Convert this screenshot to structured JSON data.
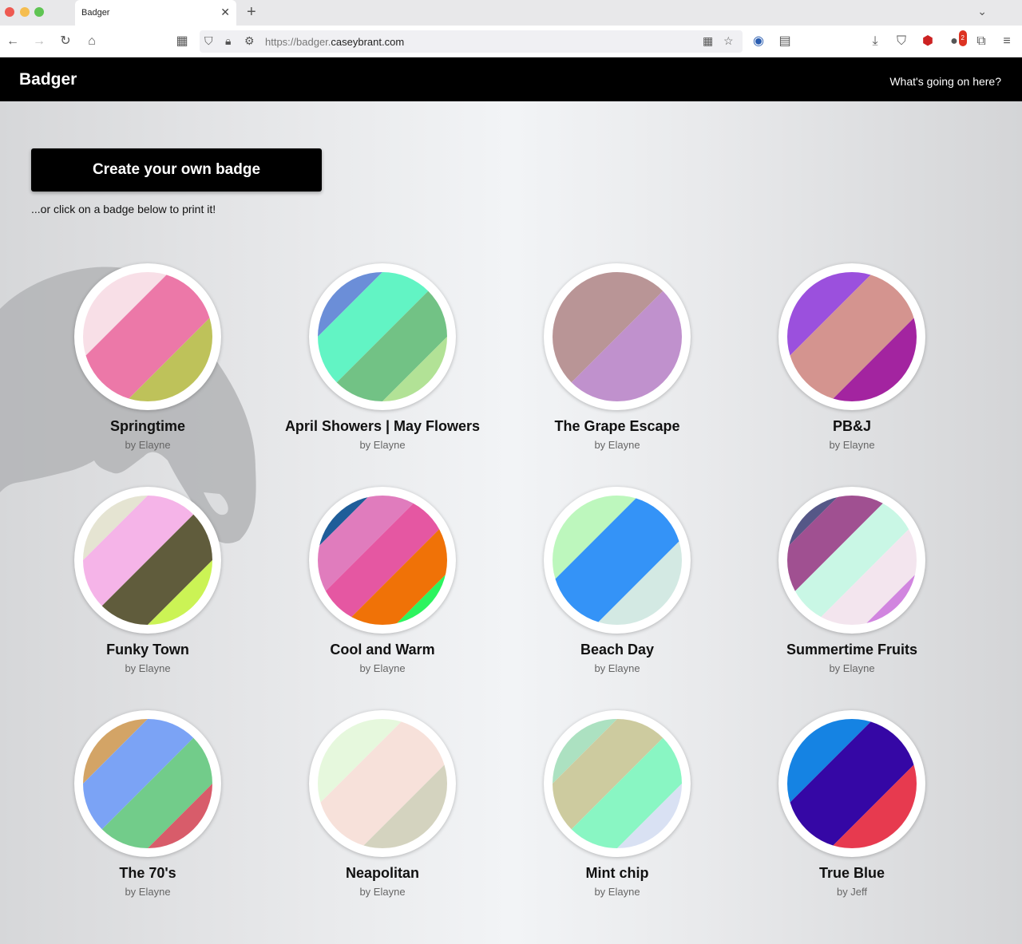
{
  "browser": {
    "tab_title": "Badger",
    "url_prefix": "https://badger.",
    "url_domain": "caseybrant.com",
    "notification_count": "2"
  },
  "header": {
    "logo": "Badger",
    "help_link": "What's going on here?"
  },
  "main": {
    "create_button": "Create your own badge",
    "hint": "...or click on a badge below to print it!"
  },
  "badges": [
    {
      "title": "Springtime",
      "author": "by Elayne",
      "colors": [
        "#f8dfe7",
        "#ec78a8",
        "#bec25a"
      ]
    },
    {
      "title": "April Showers | May Flowers",
      "author": "by Elayne",
      "colors": [
        "#6b8ed8",
        "#62f4c4",
        "#72c285",
        "#b2e296"
      ]
    },
    {
      "title": "The Grape Escape",
      "author": "by Elayne",
      "colors": [
        "#b99596",
        "#c091cd"
      ]
    },
    {
      "title": "PB&J",
      "author": "by Elayne",
      "colors": [
        "#9b50dd",
        "#d4948f",
        "#a324a0"
      ]
    },
    {
      "title": "Funky Town",
      "author": "by Elayne",
      "colors": [
        "#e5e4d2",
        "#f5b4e8",
        "#605c3c",
        "#cbf355"
      ]
    },
    {
      "title": "Cool and Warm",
      "author": "by Elayne",
      "colors": [
        "#1f5d99",
        "#e07cbd",
        "#e557a2",
        "#f07207",
        "#2cf45e"
      ]
    },
    {
      "title": "Beach Day",
      "author": "by Elayne",
      "colors": [
        "#bdf7bd",
        "#3493f7",
        "#d3e9e3"
      ]
    },
    {
      "title": "Summertime Fruits",
      "author": "by Elayne",
      "colors": [
        "#555787",
        "#a05091",
        "#c9f7e5",
        "#f3e5ee",
        "#d185df"
      ]
    },
    {
      "title": "The 70's",
      "author": "by Elayne",
      "colors": [
        "#d3a466",
        "#7ba3f5",
        "#72cc8a",
        "#d85c6a"
      ]
    },
    {
      "title": "Neapolitan",
      "author": "by Elayne",
      "colors": [
        "#e6f8dd",
        "#f7e1da",
        "#d4d3bf"
      ]
    },
    {
      "title": "Mint chip",
      "author": "by Elayne",
      "colors": [
        "#ace1c1",
        "#cdcb9f",
        "#89f6c3",
        "#d9e1f3"
      ]
    },
    {
      "title": "True Blue",
      "author": "by Jeff",
      "colors": [
        "#1583e3",
        "#3507a5",
        "#e73a4f"
      ]
    }
  ]
}
